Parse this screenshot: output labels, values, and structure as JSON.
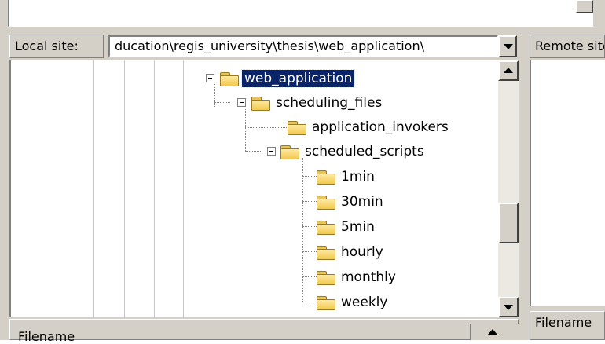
{
  "local": {
    "label": "Local site:",
    "path": "ducation\\regis_university\\thesis\\web_application\\"
  },
  "remote": {
    "label": "Remote site:",
    "filename_header": "Filename"
  },
  "bottom": {
    "filename_header": "Filename"
  },
  "tree": {
    "web_application": "web_application",
    "scheduling_files": "scheduling_files",
    "application_invokers": "application_invokers",
    "scheduled_scripts": "scheduled_scripts",
    "items": [
      "1min",
      "30min",
      "5min",
      "hourly",
      "monthly",
      "weekly"
    ]
  },
  "icons": {
    "folder": "folder-icon",
    "expander": "minus-expander-icon",
    "dropdown": "chevron-down-icon",
    "scroll_up": "scroll-up-icon",
    "scroll_down": "scroll-down-icon"
  },
  "colors": {
    "selection_bg": "#0a246a",
    "chrome": "#d4d0c8"
  }
}
